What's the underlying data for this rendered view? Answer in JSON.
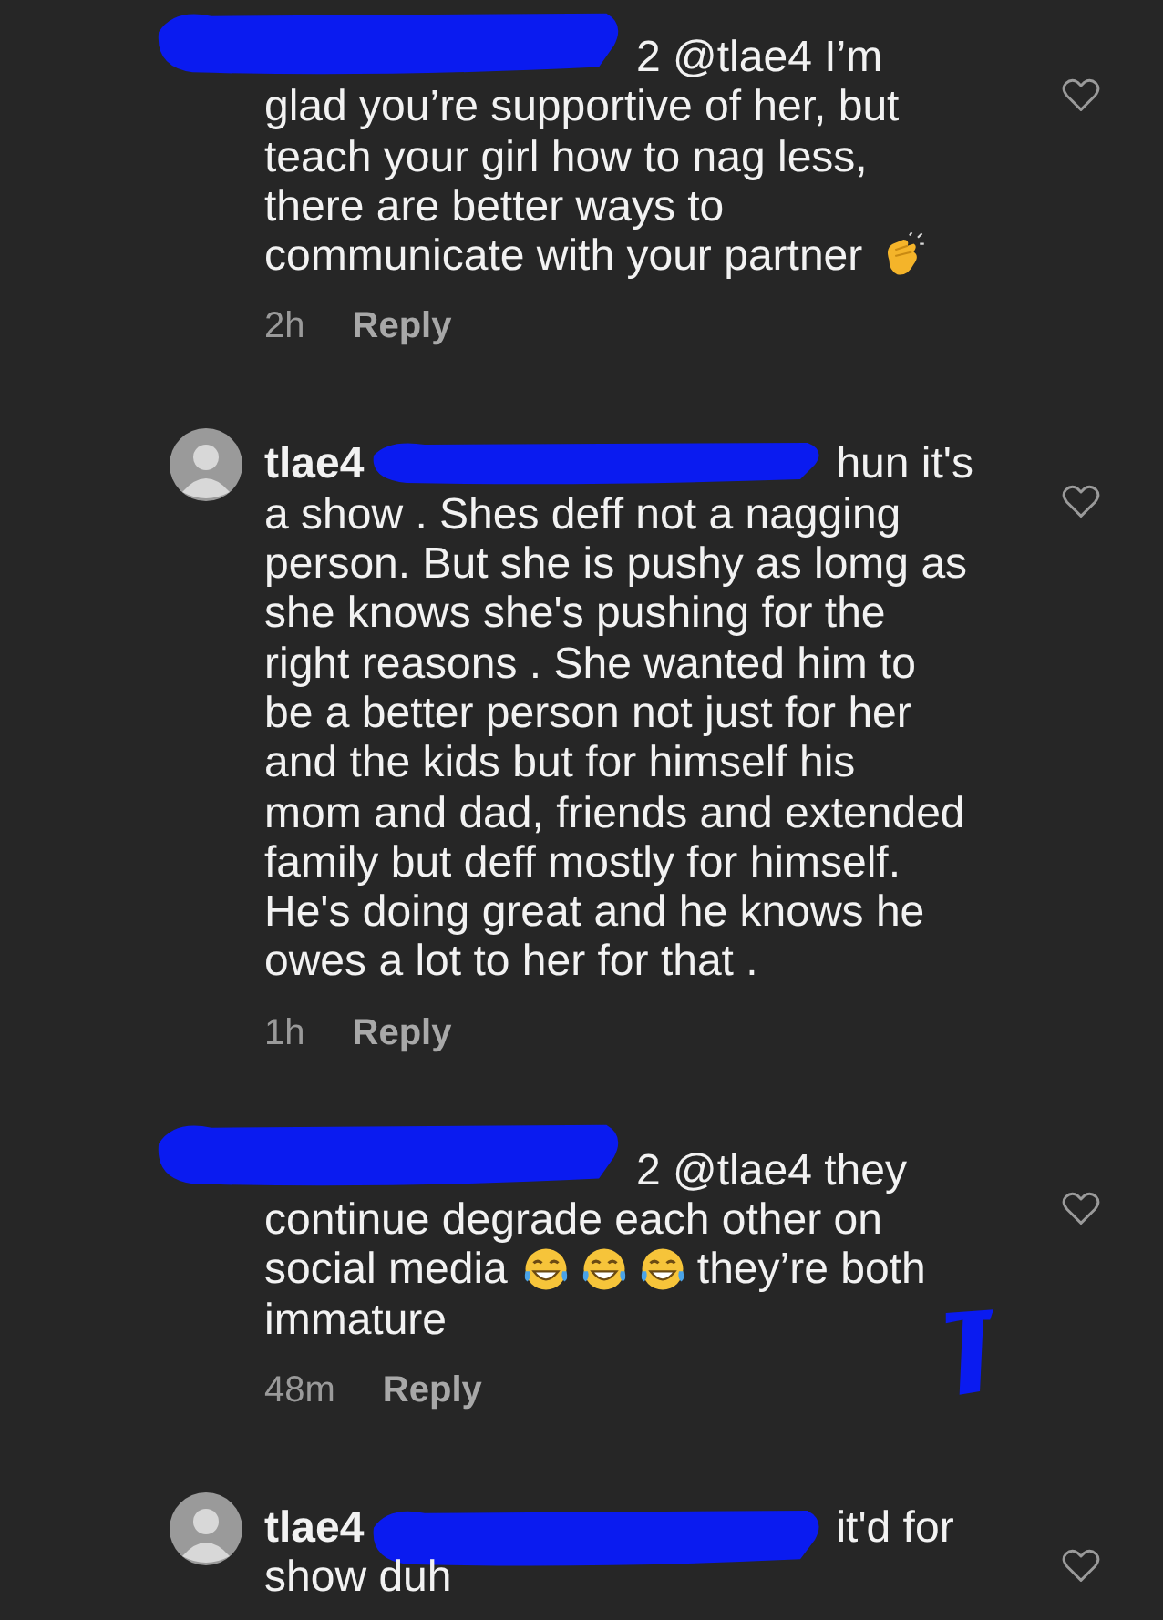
{
  "comments": [
    {
      "has_avatar": false,
      "head": "2 @tlae4 I’m",
      "lines": [
        [
          {
            "kind": "text",
            "text": "glad you’re supportive of her, but"
          }
        ],
        [
          {
            "kind": "text",
            "text": "teach your girl how to nag less,"
          }
        ],
        [
          {
            "kind": "text",
            "text": "there are better ways to"
          }
        ],
        [
          {
            "kind": "text",
            "text": "communicate with your partner"
          },
          {
            "kind": "clap-emoji"
          }
        ]
      ],
      "time": "2h",
      "reply": "Reply"
    },
    {
      "has_avatar": true,
      "username": "tlae4",
      "head": "hun it's",
      "lines": [
        [
          {
            "kind": "text",
            "text": "a show . Shes deff not a nagging"
          }
        ],
        [
          {
            "kind": "text",
            "text": "person. But she is pushy as lomg as"
          }
        ],
        [
          {
            "kind": "text",
            "text": "she knows she's pushing for the"
          }
        ],
        [
          {
            "kind": "text",
            "text": "right reasons . She wanted him to"
          }
        ],
        [
          {
            "kind": "text",
            "text": "be a better person not just for her"
          }
        ],
        [
          {
            "kind": "text",
            "text": "and the kids but for himself his"
          }
        ],
        [
          {
            "kind": "text",
            "text": "mom and dad, friends and extended"
          }
        ],
        [
          {
            "kind": "text",
            "text": "family but deff mostly for himself."
          }
        ],
        [
          {
            "kind": "text",
            "text": "He's doing great and he knows he"
          }
        ],
        [
          {
            "kind": "text",
            "text": "owes a lot to her for that ."
          }
        ]
      ],
      "time": "1h",
      "reply": "Reply"
    },
    {
      "has_avatar": false,
      "head": "2 @tlae4 they",
      "lines": [
        [
          {
            "kind": "text",
            "text": "continue degrade each other on"
          }
        ],
        [
          {
            "kind": "text",
            "text": "social media"
          },
          {
            "kind": "laugh-emoji"
          },
          {
            "kind": "laugh-emoji"
          },
          {
            "kind": "laugh-emoji"
          },
          {
            "kind": "text",
            "text": "they’re both"
          }
        ],
        [
          {
            "kind": "text",
            "text": "immature"
          }
        ]
      ],
      "time": "48m",
      "reply": "Reply"
    },
    {
      "has_avatar": true,
      "username": "tlae4",
      "head": "it'd for",
      "lines": [
        [
          {
            "kind": "text",
            "text": "show duh"
          }
        ]
      ]
    }
  ]
}
